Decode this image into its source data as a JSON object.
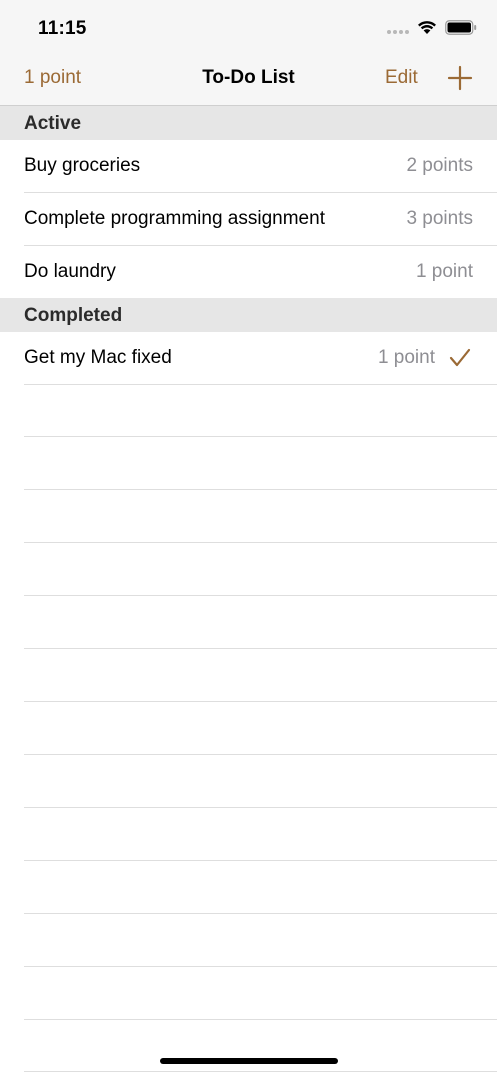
{
  "status_bar": {
    "time": "11:15"
  },
  "nav": {
    "points_label": "1 point",
    "title": "To-Do List",
    "edit_label": "Edit",
    "add_icon": "plus-icon"
  },
  "colors": {
    "accent": "#9b6a35",
    "secondary_text": "#8e8e93",
    "section_bg": "#e6e6e6"
  },
  "sections": [
    {
      "header": "Active",
      "items": [
        {
          "title": "Buy groceries",
          "points": "2 points",
          "completed": false
        },
        {
          "title": "Complete programming assignment",
          "points": "3 points",
          "completed": false
        },
        {
          "title": "Do laundry",
          "points": "1 point",
          "completed": false
        }
      ]
    },
    {
      "header": "Completed",
      "items": [
        {
          "title": "Get my Mac fixed",
          "points": "1 point",
          "completed": true
        }
      ]
    }
  ]
}
